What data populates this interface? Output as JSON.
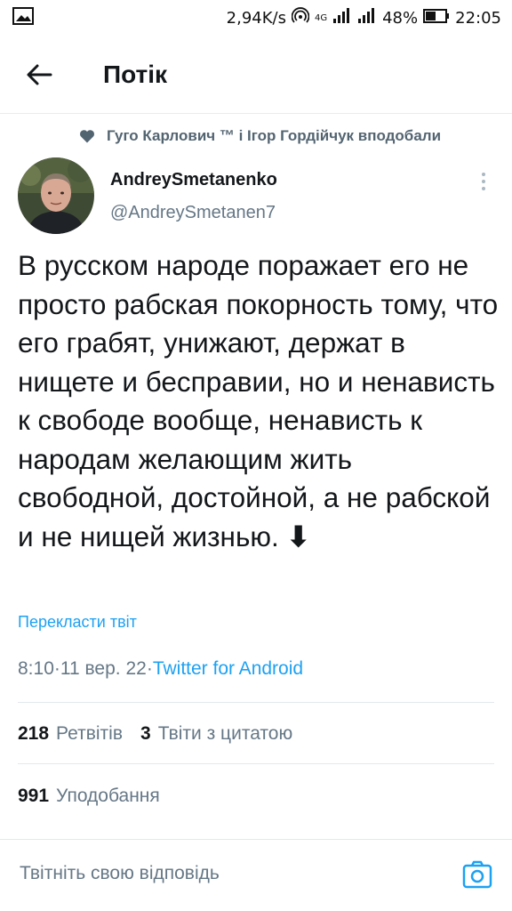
{
  "status_bar": {
    "speed": "2,94K/s",
    "network": "4G",
    "battery": "48%",
    "time": "22:05",
    "icons": [
      "gallery-icon",
      "hotspot-icon",
      "signal-icon",
      "battery-icon"
    ]
  },
  "header": {
    "title": "Потік",
    "back_icon": "arrow-left-icon"
  },
  "social_context": {
    "text": "Гуго Карлович ™ і Ігор Гордійчук вподобали",
    "icon": "heart-icon"
  },
  "tweet": {
    "author_name": "AndreySmetanenko",
    "author_handle": "@AndreySmetanen7",
    "text": "В русском народе поражает его не просто рабская покорность тому, что его грабят, унижают, держат в нищете и бесправии, но и ненависть к свободе вообще, ненависть к народам желающим жить свободной, достойной, а не рабской и не нищей жизнью. ",
    "text_emoji": "⬇",
    "translate_label": "Перекласти твіт",
    "time": "8:10",
    "date": "11 вер. 22",
    "source": "Twitter for Android",
    "separator": " · "
  },
  "stats": {
    "retweets_count": "218",
    "retweets_label": "Ретвітів",
    "quotes_count": "3",
    "quotes_label": "Твіти з цитатою",
    "likes_count": "991",
    "likes_label": "Уподобання"
  },
  "reply": {
    "placeholder": "Твітніть свою відповідь",
    "camera_icon": "camera-icon"
  },
  "colors": {
    "accent": "#1da1f2",
    "secondary_text": "#657786",
    "primary_text": "#14171a",
    "divider": "#e1e8ed"
  }
}
